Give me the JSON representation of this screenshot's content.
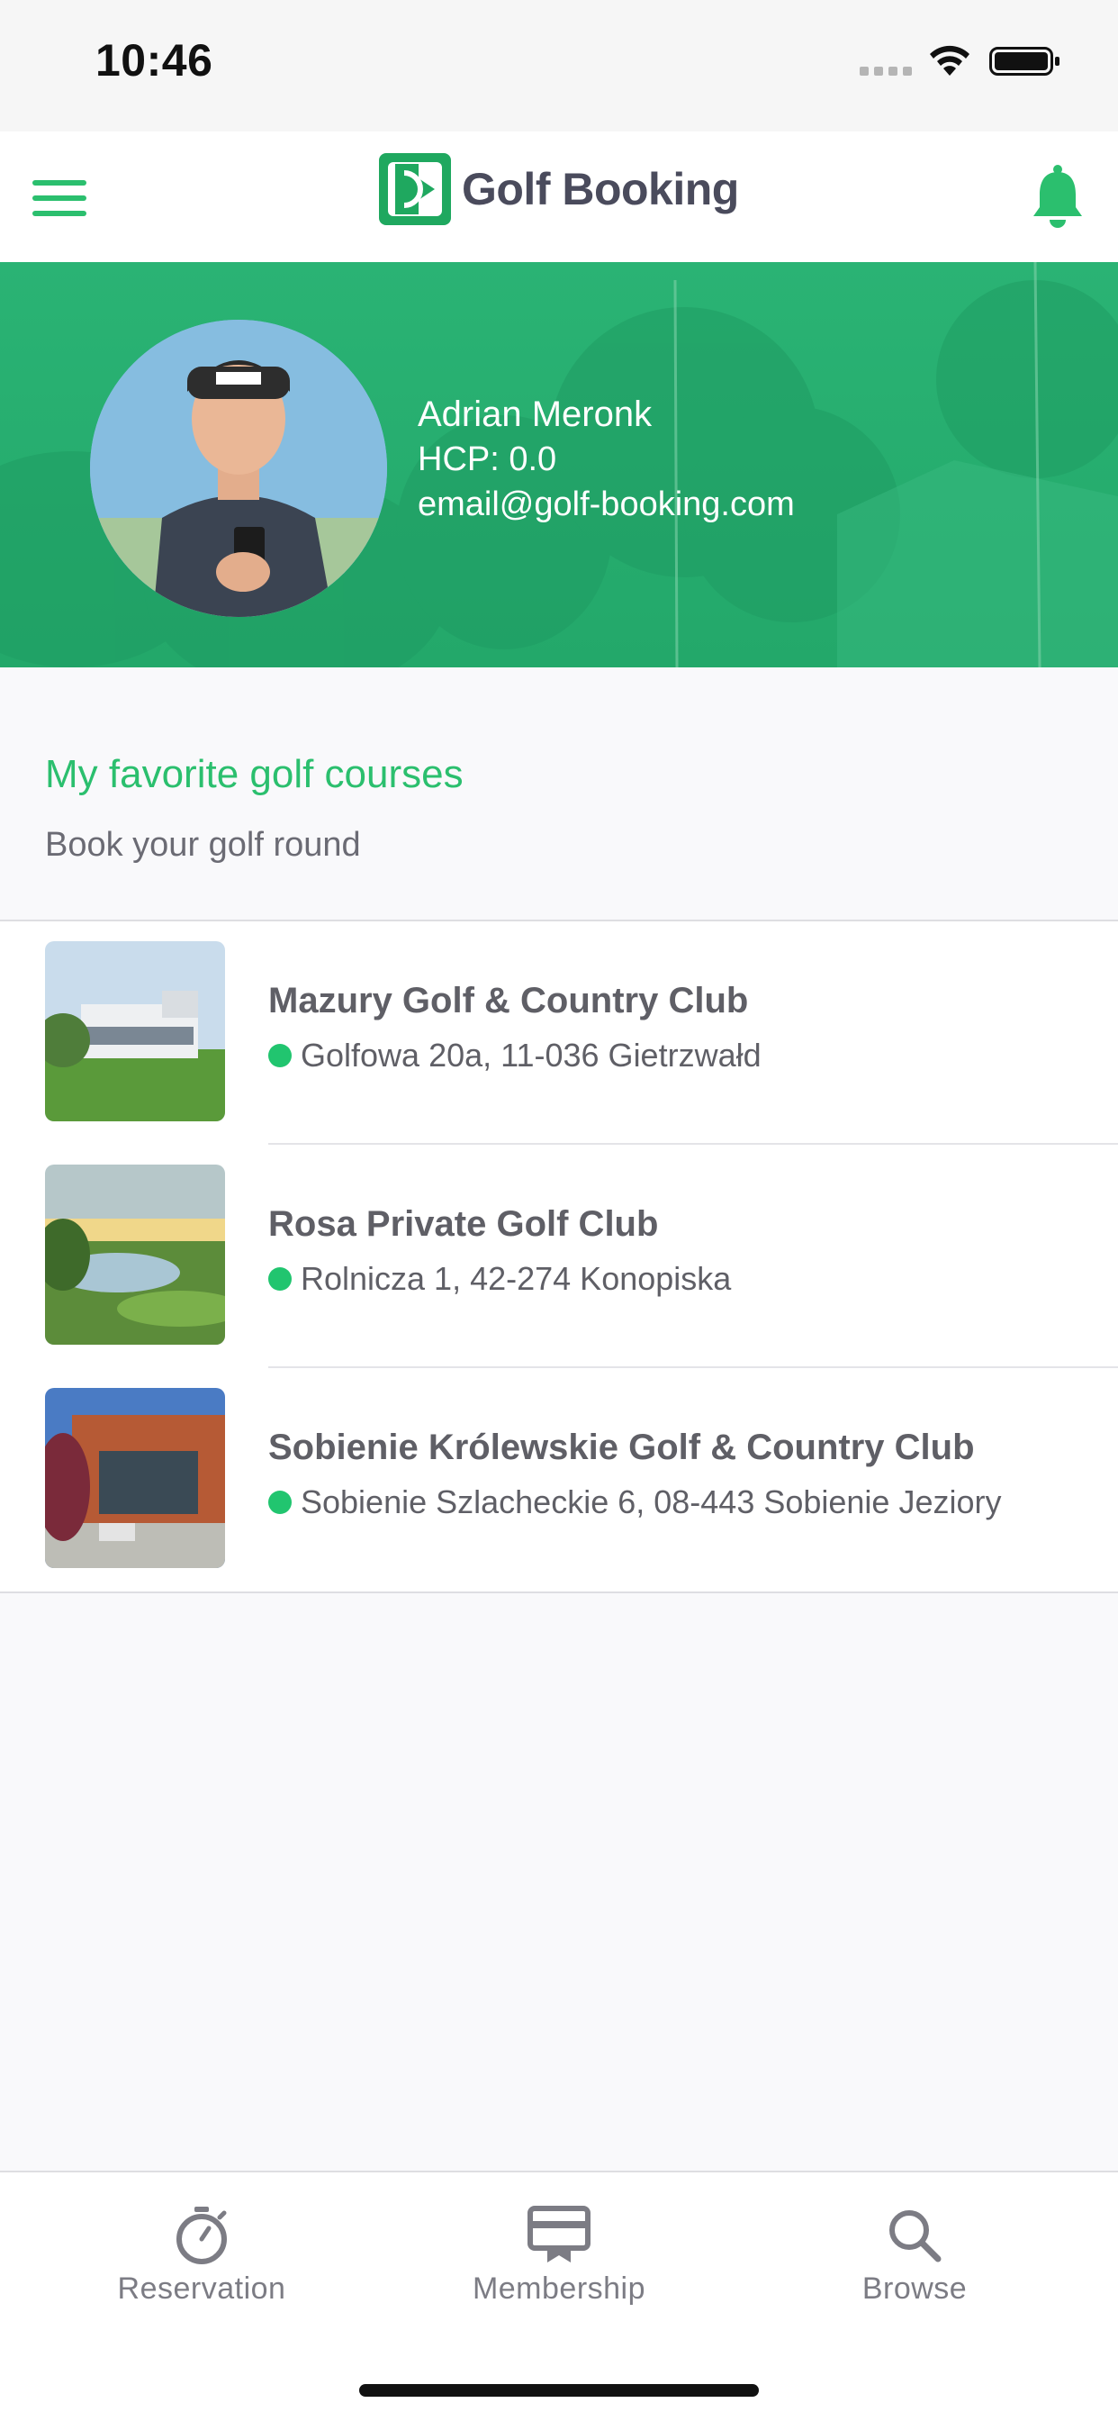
{
  "status_bar": {
    "time": "10:46"
  },
  "header": {
    "app_name": "Golf Booking",
    "accent_color": "#2bbf6e"
  },
  "profile": {
    "name": "Adrian Meronk",
    "hcp": "HCP: 0.0",
    "email": "email@golf-booking.com"
  },
  "section": {
    "title": "My favorite golf courses",
    "subtitle": "Book your golf round"
  },
  "courses": [
    {
      "name": "Mazury Golf & Country Club",
      "address": "Golfowa 20a, 11-036 Gietrzwałd"
    },
    {
      "name": "Rosa Private Golf Club",
      "address": "Rolnicza 1, 42-274 Konopiska"
    },
    {
      "name": "Sobienie Królewskie Golf & Country Club",
      "address": "Sobienie Szlacheckie 6, 08-443 Sobienie Jeziory"
    }
  ],
  "tabs": [
    {
      "label": "Reservation",
      "icon": "stopwatch-icon"
    },
    {
      "label": "Membership",
      "icon": "membership-card-icon"
    },
    {
      "label": "Browse",
      "icon": "search-icon"
    }
  ]
}
